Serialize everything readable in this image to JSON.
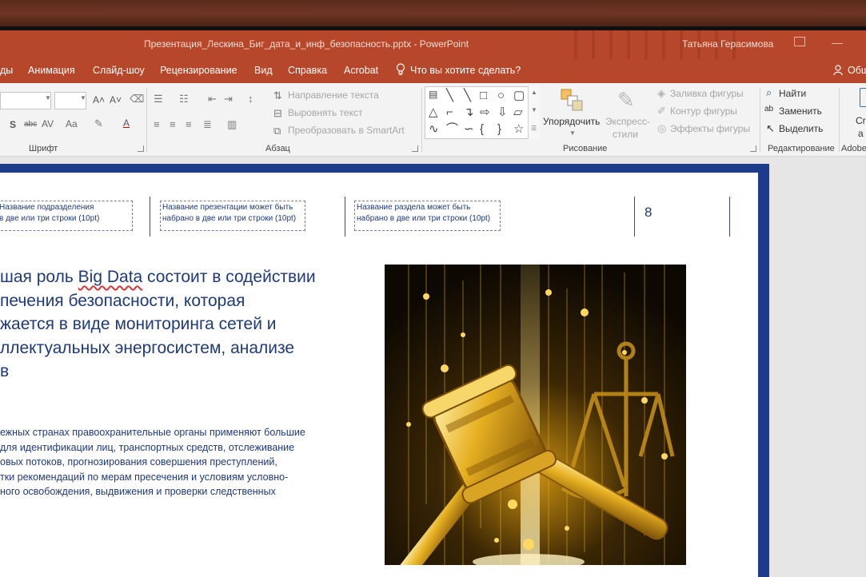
{
  "window": {
    "document_title": "Презентация_Лескина_Биг_дата_и_инф_безопасность.pptx  -  PowerPoint",
    "user_name": "Татьяна Герасимова"
  },
  "ribbon_tabs": {
    "partial_first": "ды",
    "animation": "Анимация",
    "slideshow": "Слайд-шоу",
    "review": "Рецензирование",
    "view": "Вид",
    "help": "Справка",
    "acrobat": "Acrobat",
    "tell_me": "Что вы хотите сделать?",
    "share_partial": "Общ"
  },
  "ribbon": {
    "font_group": {
      "label": "Шрифт",
      "grow": "A˄",
      "shrink": "A˅",
      "strike_label": "abc",
      "spacing": "AV",
      "case": "Aa",
      "font_color": "A"
    },
    "paragraph_group": {
      "label": "Абзац",
      "text_direction": "Направление текста",
      "align_text": "Выровнять текст",
      "smartart": "Преобразовать в SmartArt"
    },
    "drawing_group": {
      "label": "Рисование",
      "arrange": "Упорядочить",
      "quick_styles_1": "Экспресс-",
      "quick_styles_2": "стили",
      "shape_fill": "Заливка фигуры",
      "shape_outline": "Контур фигуры",
      "shape_effects": "Эффекты фигуры"
    },
    "editing_group": {
      "label": "Редактирование",
      "find": "Найти",
      "replace": "Заменить",
      "select": "Выделить"
    },
    "adobe_group": {
      "label_partial": "Adobe",
      "btn_partial_1": "Cre",
      "btn_partial_2": "a"
    }
  },
  "slide": {
    "header_box_1": "Название подразделения\nв две или три строки (10pt)",
    "header_box_2": "Название презентации может быть\nнабрано в две или три строки (10pt)",
    "header_box_3": "Название раздела может быть\nнабрано в две или три строки (10pt)",
    "page_number": "8",
    "headline_part1": "шая роль ",
    "headline_bigdata": "Big Data",
    "headline_part2": " состоит в содействии\nпечения безопасности, которая\nжается в виде мониторинга сетей и\nллектуальных энергосистем, анализе\nв",
    "body": "ежных странах правоохранительные органы применяют большие\nдля идентификации лиц, транспортных средств, отслеживание\nовых потоков, прогнозирования совершения преступлений,\nтки рекомендаций по мерам пресечения и условиям условно-\nного освобождения, выдвижения и проверки следственных"
  },
  "colors": {
    "powerpoint_accent": "#b7472a",
    "slide_text": "#1f3a78",
    "slide_frame": "#1e3c8c",
    "gold": "#e7b022"
  },
  "image": {
    "subject": "golden-gavel-and-scales-illustration"
  }
}
